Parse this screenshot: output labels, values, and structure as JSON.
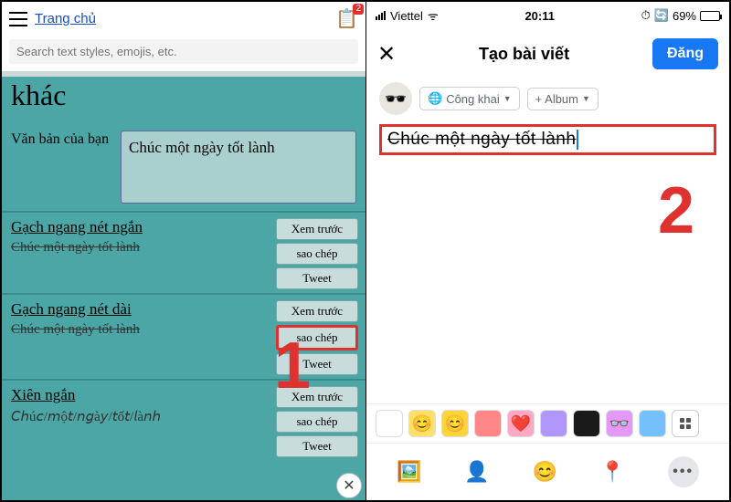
{
  "left": {
    "home_link": "Trang chủ",
    "notification_badge": "2",
    "search_placeholder": "Search text styles, emojis, etc.",
    "heading": "khác",
    "input_label": "Văn bản của bạn",
    "input_value": "Chúc một ngày tốt lành",
    "styles": [
      {
        "title": "Gạch ngang nét ngắn",
        "sample": "Chúc một ngày tốt lành",
        "strike": true,
        "btn_preview": "Xem trước",
        "btn_copy": "sao chép",
        "btn_tweet": "Tweet",
        "highlight_copy": false
      },
      {
        "title": "Gạch ngang nét dài",
        "sample": "Chúc một ngày tốt lành",
        "strike": true,
        "btn_preview": "Xem trước",
        "btn_copy": "sao chép",
        "btn_tweet": "Tweet",
        "highlight_copy": true
      },
      {
        "title": "Xiên ngắn",
        "sample": "𝘊𝘩ú𝘤/𝘮ộ𝘵/𝘯𝘨à𝘺/𝘵ố𝘵/𝘭à𝘯𝘩",
        "strike": false,
        "btn_preview": "Xem trước",
        "btn_copy": "sao chép",
        "btn_tweet": "Tweet",
        "highlight_copy": false
      }
    ]
  },
  "right": {
    "status": {
      "carrier": "Viettel",
      "time": "20:11",
      "alarm_icon": "⏰",
      "battery_pct": "69%"
    },
    "title": "Tạo bài viết",
    "post_button": "Đăng",
    "audience_chip": "Công khai",
    "album_chip": "+ Album",
    "composer_text": "Chúc một ngày tốt lành",
    "bg_options": [
      "⬜",
      "😊",
      "🟨",
      "🟥",
      "💗",
      "🟪",
      "⚫",
      "👓",
      "🌈"
    ]
  },
  "annotations": {
    "num1": "1",
    "num2": "2"
  }
}
